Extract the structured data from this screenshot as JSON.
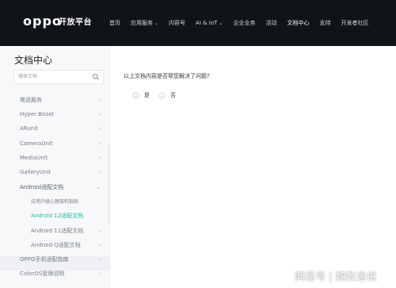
{
  "header": {
    "logo": "oppo",
    "logo_sub": "开放平台",
    "nav": [
      {
        "label": "首页",
        "has_caret": false
      },
      {
        "label": "应用服务",
        "has_caret": true
      },
      {
        "label": "内容号",
        "has_caret": false
      },
      {
        "label": "AI & IoT",
        "has_caret": true
      },
      {
        "label": "企业业务",
        "has_caret": false
      },
      {
        "label": "活动",
        "has_caret": false
      },
      {
        "label": "文档中心",
        "has_caret": false,
        "active": true
      },
      {
        "label": "支持",
        "has_caret": false
      },
      {
        "label": "开发者社区",
        "has_caret": false
      }
    ]
  },
  "sidebar": {
    "title": "文档中心",
    "search_placeholder": "搜索文档",
    "items": [
      {
        "label": "推送服务"
      },
      {
        "label": "Hyper Boost"
      },
      {
        "label": "ARunit"
      },
      {
        "label": "CameraUnit"
      },
      {
        "label": "MediaUnit"
      },
      {
        "label": "GalleryUnit"
      },
      {
        "label": "Android适配文档"
      },
      {
        "label": "应用升级心理架构指南"
      },
      {
        "label": "Android 12适配文档"
      },
      {
        "label": "Android 11适配文档"
      },
      {
        "label": "Android Q适配文档"
      },
      {
        "label": "OPPO手机适配指南"
      },
      {
        "label": "ColorOS管理说明"
      }
    ]
  },
  "content": {
    "question": "以上文档内容是否帮您解决了问题?",
    "yes": "是",
    "no": "否"
  },
  "watermark": "网易号 | 魏数途说",
  "colors": {
    "header_bg": "#101318",
    "accent": "#1db9a3",
    "sidebar_bg": "#f7f8fa"
  }
}
